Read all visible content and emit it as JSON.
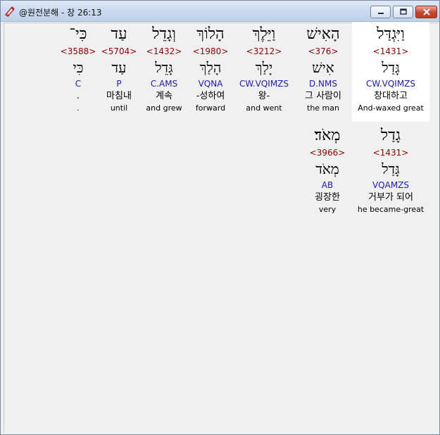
{
  "window": {
    "title": "@원전분해 - 창 26:13",
    "controls": {
      "minimize_icon": "minimize-icon",
      "maximize_icon": "maximize-icon",
      "close_icon": "close-icon"
    }
  },
  "rows": [
    [
      {
        "hebrew": "וַיִּגְדַּל",
        "strong": "<1431>",
        "lemma": "גָּדַל",
        "morph": "CW.VQIMZS",
        "korean": "창대하고",
        "english": "And-waxed great",
        "selected": true
      },
      {
        "hebrew": "הָאִישׁ",
        "strong": "<376>",
        "lemma": "אִישׁ",
        "morph": "D.NMS",
        "korean": "그 사람이",
        "english": "the man"
      },
      {
        "hebrew": "וַיֵּלֶךְ",
        "strong": "<3212>",
        "lemma": "יָלַךְ",
        "morph": "CW.VQIMZS",
        "korean": "왕-",
        "english": "and went"
      },
      {
        "hebrew": "הָלוֹךְ",
        "strong": "<1980>",
        "lemma": "הָלַךְ",
        "morph": "VQNA",
        "korean": "-성하여",
        "english": "forward"
      },
      {
        "hebrew": "וְגָדֵל",
        "strong": "<1432>",
        "lemma": "גָּדֵל",
        "morph": "C.AMS",
        "korean": "계속",
        "english": "and grew"
      },
      {
        "hebrew": "עַד",
        "strong": "<5704>",
        "lemma": "עַד",
        "morph": "P",
        "korean": "마침내",
        "english": "until"
      },
      {
        "hebrew": "כִּי־",
        "strong": "<3588>",
        "lemma": "כִּי",
        "morph": "C",
        "korean": ".",
        "english": "."
      }
    ],
    [
      {
        "hebrew": "גָדַל",
        "strong": "<1431>",
        "lemma": "גָּדַל",
        "morph": "VQAMZS",
        "korean": "거부가 되어",
        "english": "he became-great"
      },
      {
        "hebrew": "מְאֹד׃",
        "strong": "<3966>",
        "lemma": "מְאֹד",
        "morph": "AB",
        "korean": "굉장한",
        "english": "very"
      }
    ]
  ]
}
